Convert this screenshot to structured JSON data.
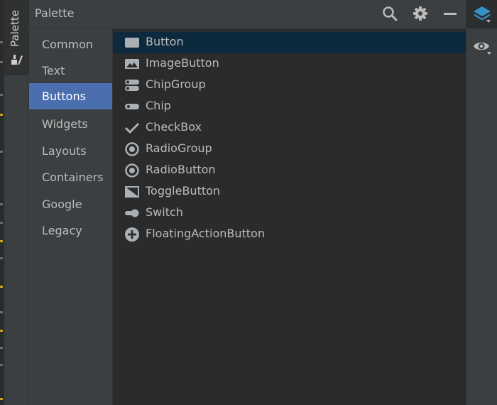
{
  "tool_window": {
    "tab_label": "Palette",
    "title": "Palette"
  },
  "header_actions": [
    {
      "name": "search-icon"
    },
    {
      "name": "gear-icon"
    },
    {
      "name": "minimize-icon"
    }
  ],
  "categories": [
    {
      "label": "Common",
      "selected": false
    },
    {
      "label": "Text",
      "selected": false
    },
    {
      "label": "Buttons",
      "selected": true
    },
    {
      "label": "Widgets",
      "selected": false
    },
    {
      "label": "Layouts",
      "selected": false
    },
    {
      "label": "Containers",
      "selected": false
    },
    {
      "label": "Google",
      "selected": false
    },
    {
      "label": "Legacy",
      "selected": false
    }
  ],
  "items": [
    {
      "label": "Button",
      "icon": "button-icon",
      "selected": true
    },
    {
      "label": "ImageButton",
      "icon": "image-icon",
      "selected": false
    },
    {
      "label": "ChipGroup",
      "icon": "chip-group-icon",
      "selected": false
    },
    {
      "label": "Chip",
      "icon": "chip-icon",
      "selected": false
    },
    {
      "label": "CheckBox",
      "icon": "checkmark-icon",
      "selected": false
    },
    {
      "label": "RadioGroup",
      "icon": "radio-icon",
      "selected": false
    },
    {
      "label": "RadioButton",
      "icon": "radio-icon",
      "selected": false
    },
    {
      "label": "ToggleButton",
      "icon": "toggle-button-icon",
      "selected": false
    },
    {
      "label": "Switch",
      "icon": "switch-icon",
      "selected": false
    },
    {
      "label": "FloatingActionButton",
      "icon": "add-circle-icon",
      "selected": false
    }
  ],
  "right_toolbar": [
    {
      "name": "layers-icon",
      "active": true
    },
    {
      "name": "eye-icon",
      "active": false
    }
  ],
  "colors": {
    "selected_category": "#4b6eaf",
    "selected_item": "#0d293e",
    "accent_blue": "#3592c4"
  }
}
